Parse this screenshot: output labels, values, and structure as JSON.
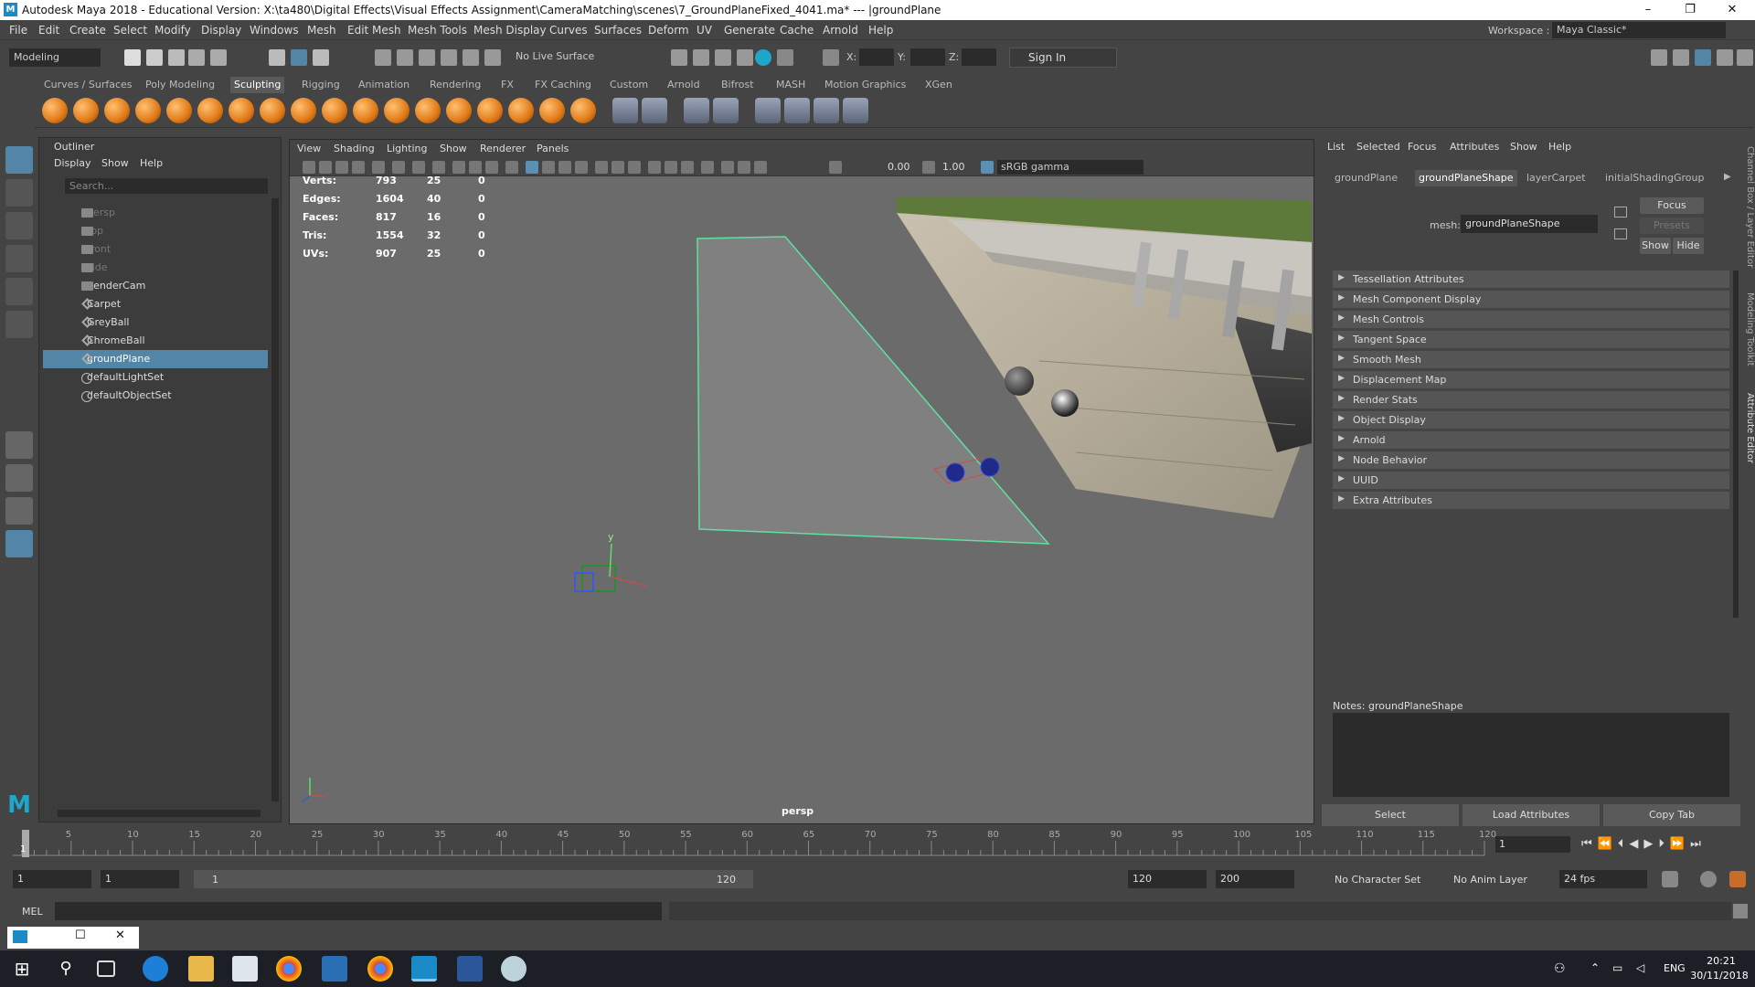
{
  "titlebar": {
    "title": "Autodesk Maya 2018 - Educational Version: X:\\ta480\\Digital Effects\\Visual Effects Assignment\\CameraMatching\\scenes\\7_GroundPlaneFixed_4041.ma*  ---  |groundPlane",
    "logo": "M"
  },
  "menu": [
    "File",
    "Edit",
    "Create",
    "Select",
    "Modify",
    "Display",
    "Windows",
    "Mesh",
    "Edit Mesh",
    "Mesh Tools",
    "Mesh Display",
    "Curves",
    "Surfaces",
    "Deform",
    "UV",
    "Generate",
    "Cache",
    "Arnold",
    "Help"
  ],
  "workspace": {
    "label": "Workspace :",
    "value": "Maya Classic*"
  },
  "status": {
    "mode": "Modeling",
    "live_surface": "No Live Surface",
    "x_label": "X:",
    "y_label": "Y:",
    "z_label": "Z:",
    "sign_in": "Sign In"
  },
  "shelf_tabs": [
    "Curves / Surfaces",
    "Poly Modeling",
    "Sculpting",
    "Rigging",
    "Animation",
    "Rendering",
    "FX",
    "FX Caching",
    "Custom",
    "Arnold",
    "Bifrost",
    "MASH",
    "Motion Graphics",
    "XGen"
  ],
  "shelf_active": "Sculpting",
  "outliner": {
    "title": "Outliner",
    "menu": [
      "Display",
      "Show",
      "Help"
    ],
    "search_placeholder": "Search...",
    "items": [
      {
        "label": "persp",
        "icon": "camera-icon",
        "state": "dim"
      },
      {
        "label": "top",
        "icon": "camera-icon",
        "state": "dim"
      },
      {
        "label": "front",
        "icon": "camera-icon",
        "state": "dim"
      },
      {
        "label": "side",
        "icon": "camera-icon",
        "state": "dim"
      },
      {
        "label": "RenderCam",
        "icon": "camera-icon",
        "state": "normal"
      },
      {
        "label": "Carpet",
        "icon": "mesh-icon",
        "state": "normal"
      },
      {
        "label": "GreyBall",
        "icon": "mesh-icon",
        "state": "normal"
      },
      {
        "label": "ChromeBall",
        "icon": "mesh-icon",
        "state": "normal"
      },
      {
        "label": "groundPlane",
        "icon": "mesh-icon",
        "state": "selected"
      },
      {
        "label": "defaultLightSet",
        "icon": "set-icon",
        "state": "normal"
      },
      {
        "label": "defaultObjectSet",
        "icon": "set-icon",
        "state": "normal"
      }
    ]
  },
  "viewport": {
    "menu": [
      "View",
      "Shading",
      "Lighting",
      "Show",
      "Renderer",
      "Panels"
    ],
    "exposure": "0.00",
    "gamma": "1.00",
    "color_space": "sRGB gamma",
    "camera": "persp",
    "hud": [
      {
        "label": "Verts:",
        "a": "793",
        "b": "25",
        "c": "0"
      },
      {
        "label": "Edges:",
        "a": "1604",
        "b": "40",
        "c": "0"
      },
      {
        "label": "Faces:",
        "a": "817",
        "b": "16",
        "c": "0"
      },
      {
        "label": "Tris:",
        "a": "1554",
        "b": "32",
        "c": "0"
      },
      {
        "label": "UVs:",
        "a": "907",
        "b": "25",
        "c": "0"
      }
    ],
    "axis_y": "y"
  },
  "attr": {
    "menu": [
      "List",
      "Selected",
      "Focus",
      "Attributes",
      "Show",
      "Help"
    ],
    "tabs": [
      "groundPlane",
      "groundPlaneShape",
      "layerCarpet",
      "initialShadingGroup"
    ],
    "active_tab": "groundPlaneShape",
    "mesh_label": "mesh:",
    "mesh_value": "groundPlaneShape",
    "focus": "Focus",
    "presets": "Presets",
    "show": "Show",
    "hide": "Hide",
    "sections": [
      "Tessellation Attributes",
      "Mesh Component Display",
      "Mesh Controls",
      "Tangent Space",
      "Smooth Mesh",
      "Displacement Map",
      "Render Stats",
      "Object Display",
      "Arnold",
      "Node Behavior",
      "UUID",
      "Extra Attributes"
    ],
    "notes_label": "Notes:  groundPlaneShape",
    "buttons": [
      "Select",
      "Load Attributes",
      "Copy Tab"
    ]
  },
  "side_tabs": [
    "Channel Box / Layer Editor",
    "Modeling Toolkit",
    "Attribute Editor"
  ],
  "timeline": {
    "ticks": [
      "5",
      "10",
      "15",
      "20",
      "25",
      "30",
      "35",
      "40",
      "45",
      "50",
      "55",
      "60",
      "65",
      "70",
      "75",
      "80",
      "85",
      "90",
      "95",
      "100",
      "105",
      "110",
      "115",
      "120"
    ],
    "current_frame": "1",
    "start_marker": "1"
  },
  "range": {
    "start": "1",
    "start2": "1",
    "slider_start": "1",
    "slider_end": "120",
    "end": "120",
    "end2": "200",
    "char_set": "No Character Set",
    "anim_layer": "No Anim Layer",
    "fps": "24 fps"
  },
  "cmd": {
    "label": "MEL"
  },
  "taskbar": {
    "lang": "ENG",
    "time": "20:21",
    "date": "30/11/2018"
  },
  "colors": {
    "accent": "#5285a6",
    "shelf_orange": "#e07a18",
    "plane_edge": "#5fe0a0"
  }
}
